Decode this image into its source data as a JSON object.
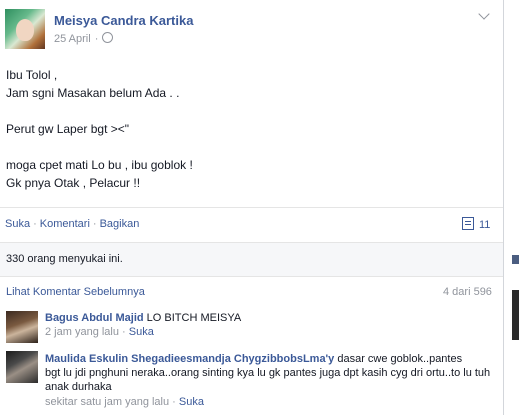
{
  "post": {
    "author": "Meisya Candra Kartika",
    "date": "25 April",
    "lines": [
      "Ibu Tolol ,",
      "Jam sgni Masakan belum Ada . .",
      "",
      "Perut gw Laper bgt ><\"",
      "",
      "moga cpet mati Lo bu , ibu goblok !",
      "Gk pnya Otak , Pelacur !!"
    ]
  },
  "actions": {
    "like": "Suka",
    "comment": "Komentari",
    "share": "Bagikan",
    "comment_count": "11"
  },
  "likes_text": "330 orang menyukai ini.",
  "comments_header": {
    "view_previous": "Lihat Komentar Sebelumnya",
    "pager": "4 dari 596"
  },
  "comments": [
    {
      "name": "Bagus Abdul Majid",
      "text": "LO BITCH MEISYA",
      "time": "2 jam yang lalu",
      "like": "Suka"
    },
    {
      "name": "Maulida Eskulin Shegadieesmandja ChygzibbobsLma'y",
      "text_line1": "dasar cwe goblok..pantes",
      "text_line2": "bgt lu jdi pnghuni neraka..orang sinting kya lu gk pantes juga dpt kasih cyg dri ortu..to lu tuh",
      "text_line3": "anak durhaka",
      "time": "sekitar satu jam yang lalu",
      "like": "Suka"
    }
  ],
  "icons": {
    "privacy": "globe-icon",
    "menu": "chevron-down-icon",
    "comments": "comment-icon"
  },
  "colors": {
    "link": "#3b5998",
    "muted": "#90949c",
    "text": "#141823"
  }
}
